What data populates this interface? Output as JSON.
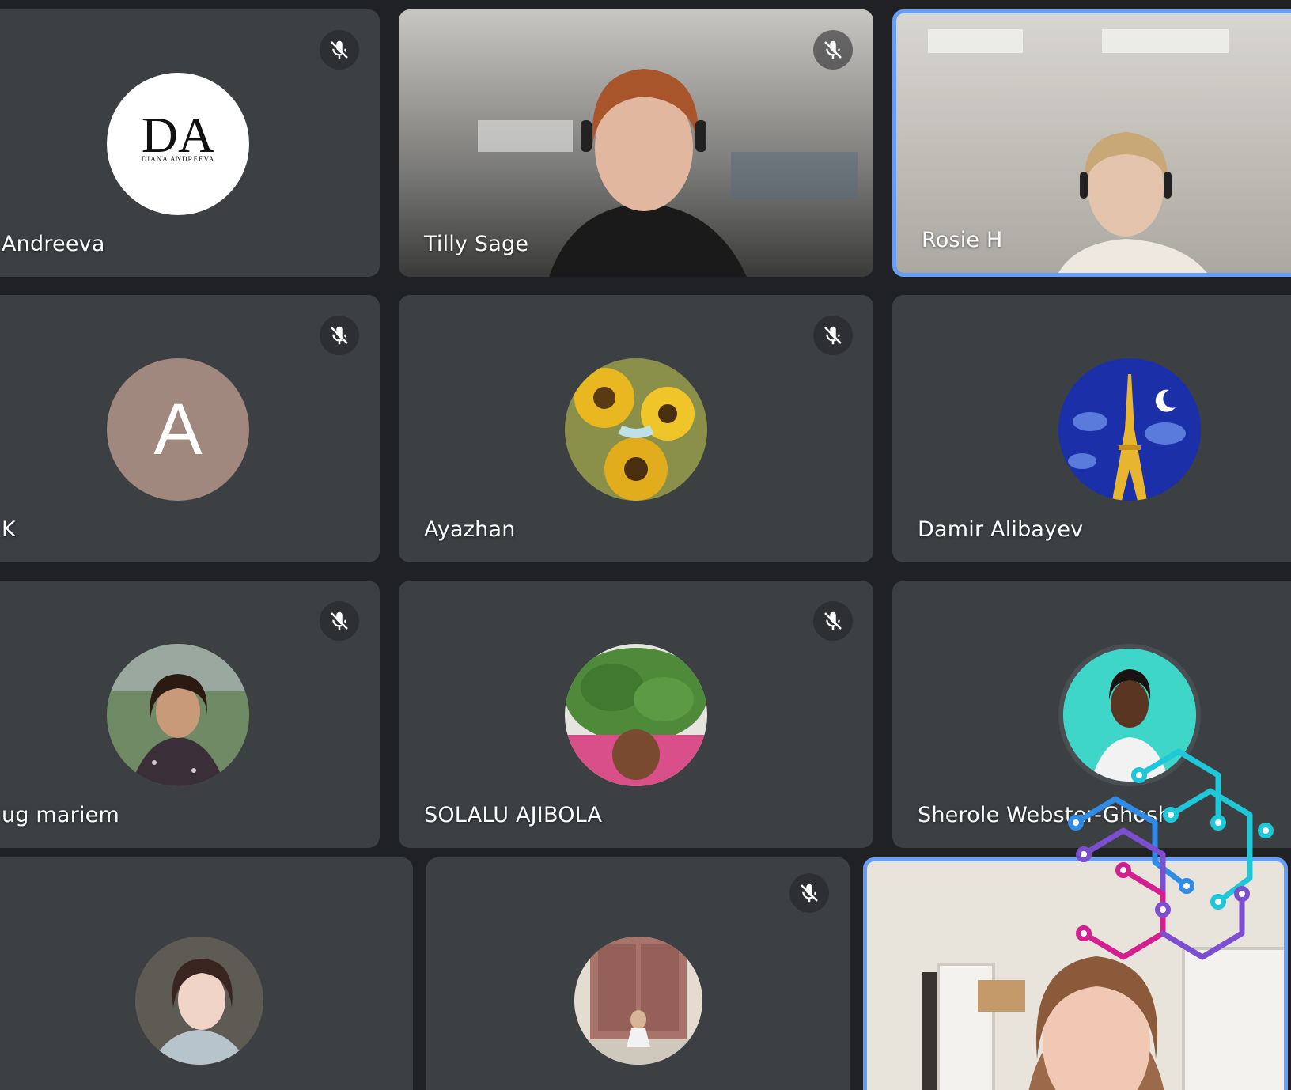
{
  "participants": [
    {
      "name": "Andreeva",
      "muted": true,
      "avatar_type": "logo",
      "logo_initials": "DA",
      "logo_text": "DIANA ANDREEVA"
    },
    {
      "name": "Tilly Sage",
      "muted": true,
      "avatar_type": "video"
    },
    {
      "name": "Rosie H",
      "muted": false,
      "avatar_type": "video",
      "speaking": true
    },
    {
      "name": "K",
      "muted": true,
      "avatar_type": "letter",
      "avatar_letter": "A",
      "avatar_color": "#a1887f"
    },
    {
      "name": "Ayazhan",
      "muted": true,
      "avatar_type": "photo",
      "photo_icon": "sunflower-photo"
    },
    {
      "name": "Damir Alibayev",
      "muted": false,
      "avatar_type": "photo",
      "photo_icon": "eiffel-tower-photo"
    },
    {
      "name": "ug mariem",
      "muted": true,
      "avatar_type": "photo",
      "photo_icon": "portrait-photo"
    },
    {
      "name": "SOLALU AJIBOLA",
      "muted": true,
      "avatar_type": "photo",
      "photo_icon": "tree-mural-photo"
    },
    {
      "name": "Sherole Webster-Ghosh",
      "muted": false,
      "avatar_type": "photo",
      "photo_icon": "portrait-photo"
    },
    {
      "name": "",
      "muted": false,
      "avatar_type": "photo",
      "photo_icon": "portrait-photo"
    },
    {
      "name": "",
      "muted": true,
      "avatar_type": "photo",
      "photo_icon": "building-door-photo"
    },
    {
      "name": "",
      "muted": false,
      "avatar_type": "video",
      "speaking": true
    }
  ],
  "icons": {
    "mute": "mic-off-icon",
    "overlay_logo": "circuit-hexagon-logo"
  },
  "colors": {
    "background": "#202124",
    "tile": "#3c4043",
    "speaking_border": "#669df6",
    "logo_cyan": "#1ec8d8",
    "logo_blue": "#2f8be6",
    "logo_purple": "#7b4fd0",
    "logo_magenta": "#d4208f"
  }
}
